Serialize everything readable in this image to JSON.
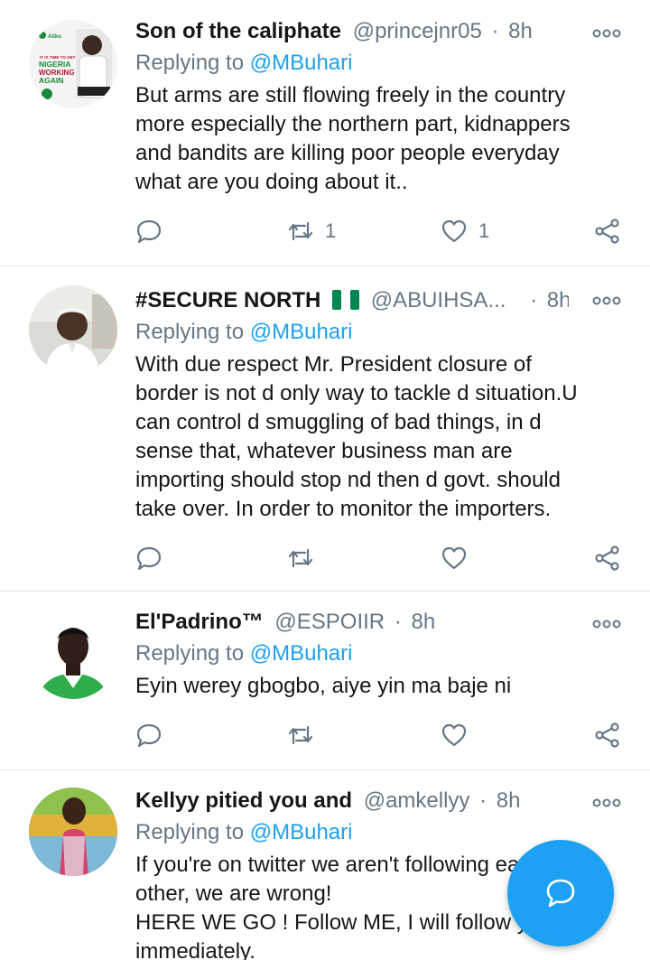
{
  "tweets": [
    {
      "name": "Son of the caliphate",
      "handle": "@princejnr05",
      "separator": "·",
      "time": "8h",
      "replying_label": "Replying to",
      "replying_handle": "@MBuhari",
      "body_lines": [
        "But arms are still flowing freely in the country",
        "more especially the northern part, kidnappers",
        "and bandits are killing poor people everyday",
        "what are you doing about it.."
      ],
      "retweet_count": "1",
      "like_count": "1",
      "avatar_text": {
        "brand": "Atiku",
        "line1": "IT IS TIME TO GET",
        "line2": "NIGERIA",
        "line3": "WORKING",
        "line4": "AGAIN"
      }
    },
    {
      "name": "#SECURE NORTH",
      "flag": "Nigeria flag",
      "handle": "@ABUIHSA...",
      "separator": "·",
      "time": "8h",
      "replying_label": "Replying to",
      "replying_handle": "@MBuhari",
      "body_lines": [
        "With due respect Mr. President closure of",
        "border is not d only way to tackle d situation.U",
        "can control d smuggling of bad things, in d",
        "sense that, whatever business man are",
        "importing should stop nd then d govt. should",
        "take over. In order to monitor the importers."
      ],
      "retweet_count": "",
      "like_count": ""
    },
    {
      "name": "El'Padrino™",
      "handle": "@ESPOIIR",
      "separator": "·",
      "time": "8h",
      "replying_label": "Replying to",
      "replying_handle": "@MBuhari",
      "body_lines": [
        "Eyin werey gbogbo, aiye yin ma baje ni"
      ],
      "retweet_count": "",
      "like_count": ""
    },
    {
      "name": "Kellyy pitied you and",
      "handle": "@amkellyy",
      "separator": "·",
      "time": "8h",
      "replying_label": "Replying to",
      "replying_handle": "@MBuhari",
      "body_lines": [
        "If you're on twitter we aren't following each",
        "other, we are wrong!",
        "HERE WE GO ! Follow ME, I will follow you",
        "immediately."
      ]
    }
  ],
  "icons": {
    "more": "more-options-icon",
    "reply": "reply-icon",
    "retweet": "retweet-icon",
    "like": "like-icon",
    "share": "share-icon",
    "compose": "compose-reply-icon"
  },
  "colors": {
    "accent": "#1da1f2",
    "muted": "#657786",
    "text": "#14171a",
    "divider": "#dfe3e7",
    "nigeria_green": "#008751"
  }
}
